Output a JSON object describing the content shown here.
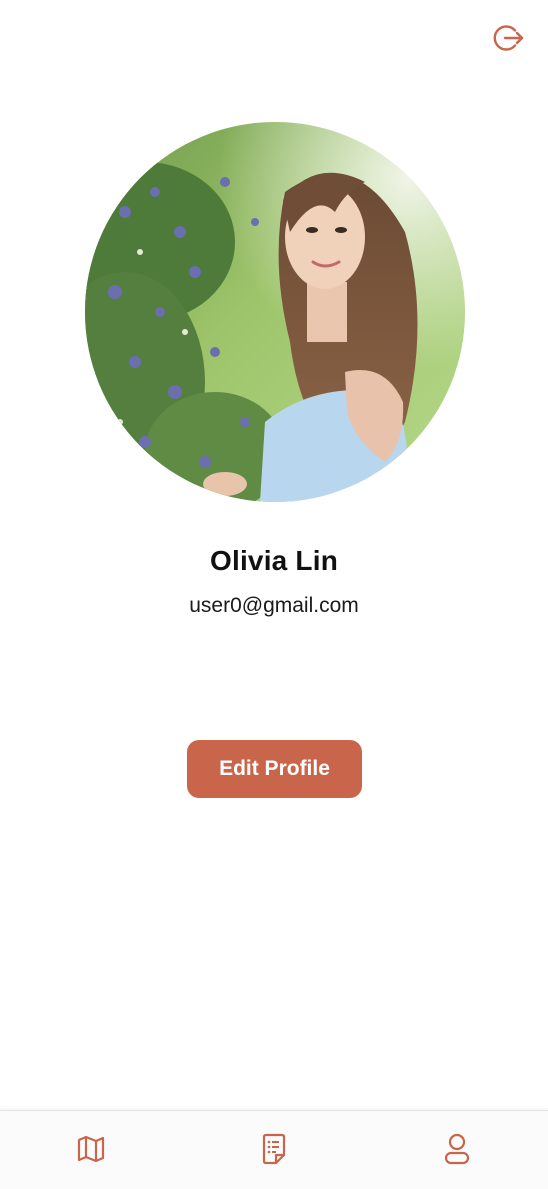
{
  "header": {
    "logout_icon": "logout-icon"
  },
  "profile": {
    "name": "Olivia Lin",
    "email": "user0@gmail.com",
    "edit_button_label": "Edit Profile"
  },
  "tabbar": {
    "items": [
      {
        "icon": "map-icon"
      },
      {
        "icon": "notes-icon"
      },
      {
        "icon": "profile-icon"
      }
    ]
  },
  "colors": {
    "accent": "#c9654a",
    "text": "#111111",
    "background": "#ffffff"
  }
}
